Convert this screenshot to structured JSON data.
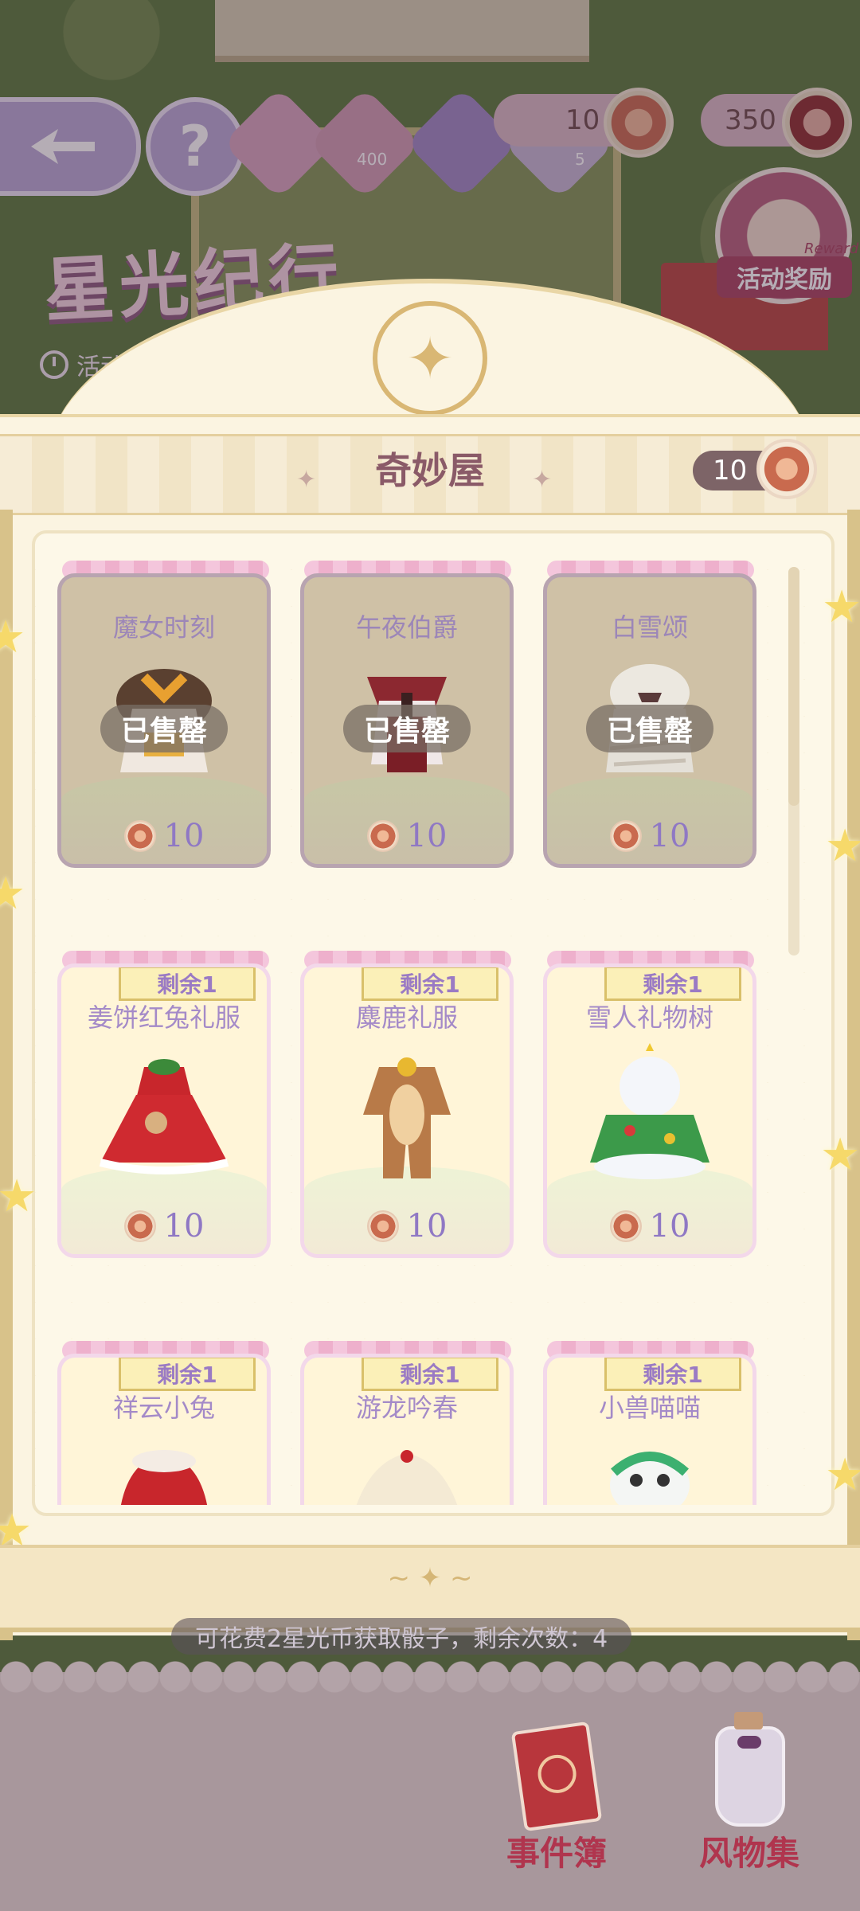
{
  "hud": {
    "help_glyph": "?",
    "tile_label": "400",
    "tile_label_2": "5",
    "currency_1": "10",
    "currency_2": "350"
  },
  "event": {
    "title": "星光纪行",
    "time_prefix": "活动剩",
    "reward_label": "活动奖励",
    "reward_en": "Reward"
  },
  "shop": {
    "title": "奇妙屋",
    "coin_count": "10",
    "emblem_glyph": "✦"
  },
  "items": [
    {
      "name": "魔女时刻",
      "price": "10",
      "sold": true,
      "status": "已售罄"
    },
    {
      "name": "午夜伯爵",
      "price": "10",
      "sold": true,
      "status": "已售罄"
    },
    {
      "name": "白雪颂",
      "price": "10",
      "sold": true,
      "status": "已售罄"
    },
    {
      "name": "姜饼红兔礼服",
      "price": "10",
      "sold": false,
      "remaining": "剩余1"
    },
    {
      "name": "麋鹿礼服",
      "price": "10",
      "sold": false,
      "remaining": "剩余1"
    },
    {
      "name": "雪人礼物树",
      "price": "10",
      "sold": false,
      "remaining": "剩余1"
    },
    {
      "name": "祥云小兔",
      "price": "",
      "sold": false,
      "remaining": "剩余1"
    },
    {
      "name": "游龙吟春",
      "price": "",
      "sold": false,
      "remaining": "剩余1"
    },
    {
      "name": "小兽喵喵",
      "price": "",
      "sold": false,
      "remaining": "剩余1"
    }
  ],
  "hint": "可花费2星光币获取骰子，剩余次数：4",
  "nav": {
    "events_book": "事件簿",
    "collection": "风物集"
  },
  "colors": {
    "panel_bg": "#fbf4e1",
    "accent_purple": "#8f78c4",
    "title_color": "#8a5a68",
    "nav_red": "#b0354e"
  }
}
